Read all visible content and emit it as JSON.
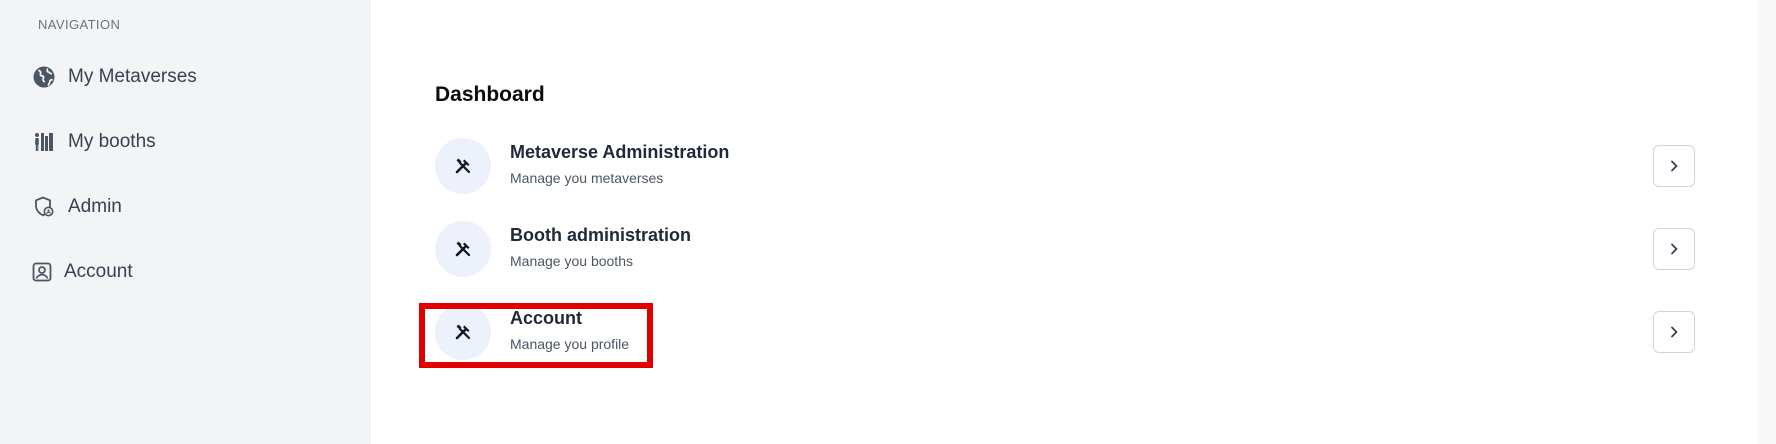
{
  "sidebar": {
    "heading": "NAVIGATION",
    "items": [
      {
        "label": "My Metaverses",
        "icon": "globe-icon"
      },
      {
        "label": "My booths",
        "icon": "booths-icon"
      },
      {
        "label": "Admin",
        "icon": "shield-icon"
      },
      {
        "label": "Account",
        "icon": "account-icon"
      }
    ]
  },
  "main": {
    "title": "Dashboard",
    "rows": [
      {
        "title": "Metaverse Administration",
        "subtitle": "Manage you metaverses",
        "icon": "tools-icon",
        "action_icon": "chevron-right-icon"
      },
      {
        "title": "Booth administration",
        "subtitle": "Manage you booths",
        "icon": "tools-icon",
        "action_icon": "chevron-right-icon"
      },
      {
        "title": "Account",
        "subtitle": "Manage you profile",
        "icon": "tools-icon",
        "action_icon": "chevron-right-icon"
      }
    ]
  },
  "annotation": {
    "highlight_color": "#e00000",
    "highlighted_item": "Account"
  },
  "colors": {
    "sidebar_bg": "#f3f4f6",
    "icon_circle_bg": "#edf1fb",
    "icon_color": "#0f172a"
  }
}
